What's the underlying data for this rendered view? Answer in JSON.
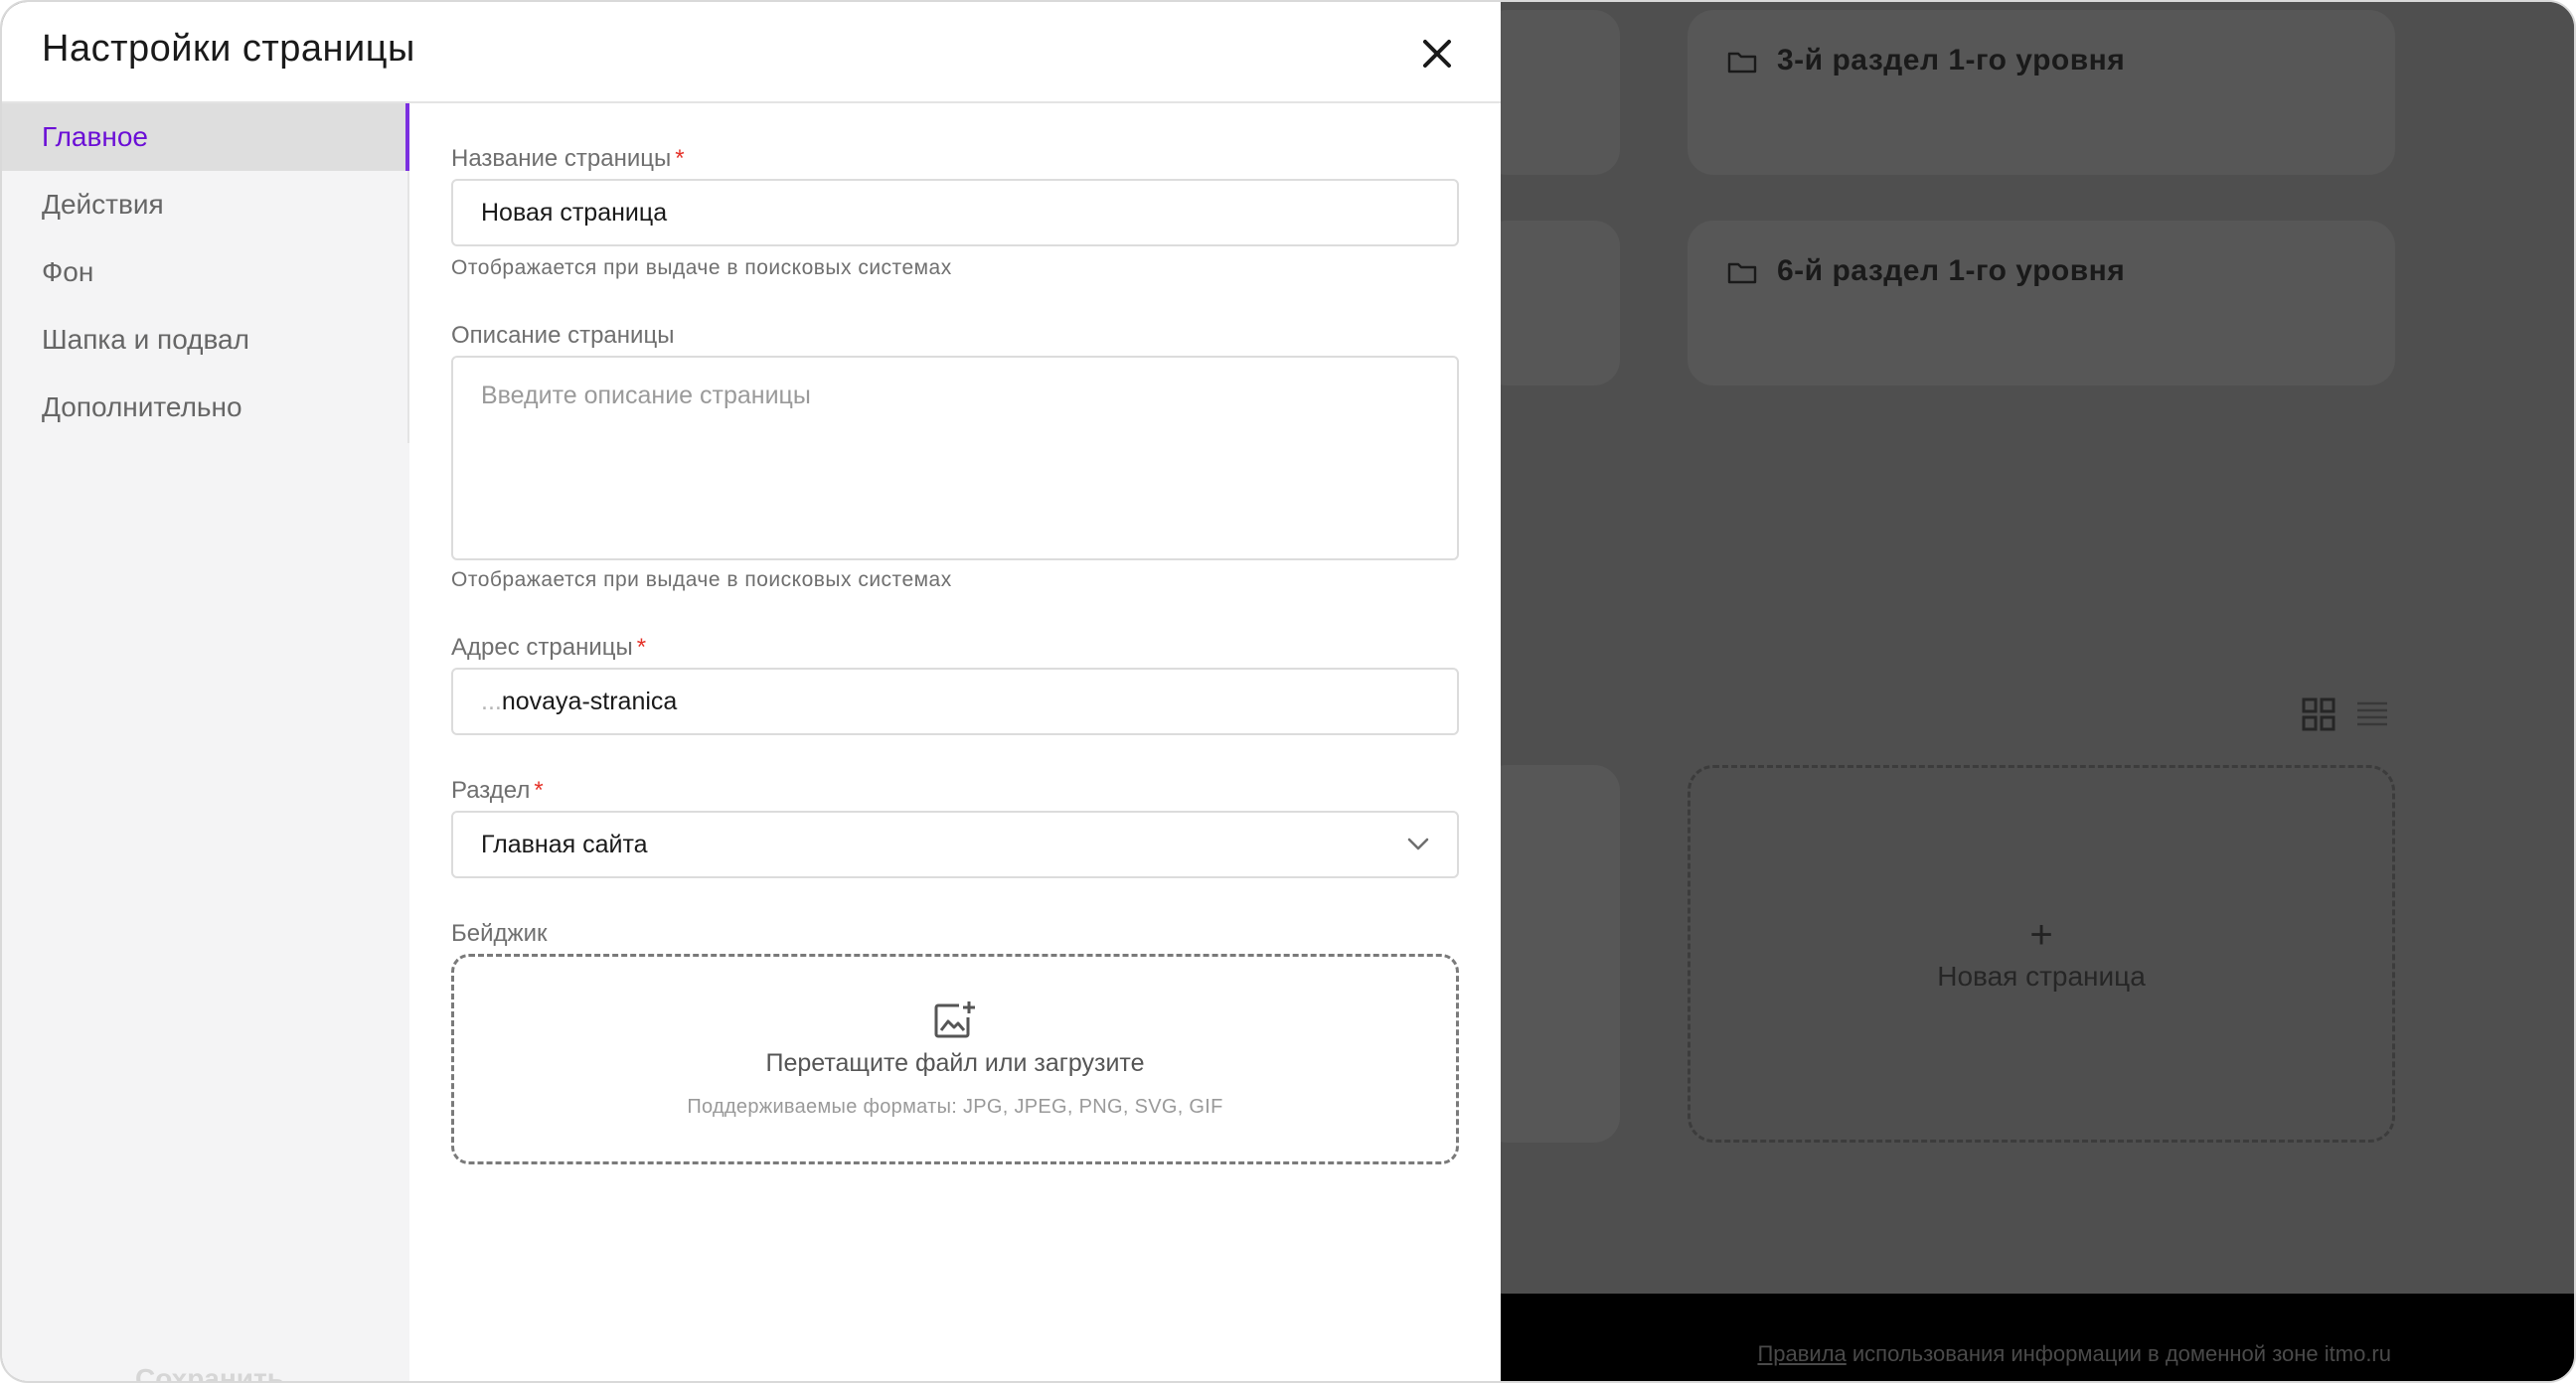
{
  "modal": {
    "title": "Настройки страницы",
    "close_icon": "close-icon"
  },
  "sidebar": {
    "items": [
      {
        "label": "Главное",
        "active": true
      },
      {
        "label": "Действия",
        "active": false
      },
      {
        "label": "Фон",
        "active": false
      },
      {
        "label": "Шапка и подвал",
        "active": false
      },
      {
        "label": "Дополнительно",
        "active": false
      }
    ],
    "save_label": "Сохранить"
  },
  "form": {
    "page_name": {
      "label": "Название страницы",
      "required_mark": "*",
      "value": "Новая страница",
      "hint": "Отображается при выдаче в поисковых системах"
    },
    "page_description": {
      "label": "Описание страницы",
      "value": "",
      "placeholder": "Введите описание страницы",
      "hint": "Отображается при выдаче в поисковых системах"
    },
    "page_address": {
      "label": "Адрес страницы",
      "required_mark": "*",
      "prefix": "...",
      "value": "novaya-stranica"
    },
    "section": {
      "label": "Раздел",
      "required_mark": "*",
      "selected": "Главная сайта"
    },
    "badge": {
      "label": "Бейджик",
      "dropzone_title": "Перетащите файл или загрузите",
      "dropzone_formats": "Поддерживаемые форматы: JPG, JPEG, PNG, SVG, GIF"
    }
  },
  "background": {
    "cards": [
      {
        "title": "3-й раздел 1-го уровня",
        "icon": "folder-icon"
      },
      {
        "title": "6-й раздел 1-го уровня",
        "icon": "folder-icon"
      }
    ],
    "new_page": {
      "plus": "+",
      "label": "Новая страница"
    },
    "view_icons": [
      "grid-view-icon",
      "list-view-icon"
    ],
    "footer": {
      "link": "Правила",
      "text": " использования информации в доменной зоне itmo.ru"
    }
  },
  "colors": {
    "accent": "#6b0fd6",
    "required": "#e5332a",
    "overlay": "#4f4f4f"
  }
}
